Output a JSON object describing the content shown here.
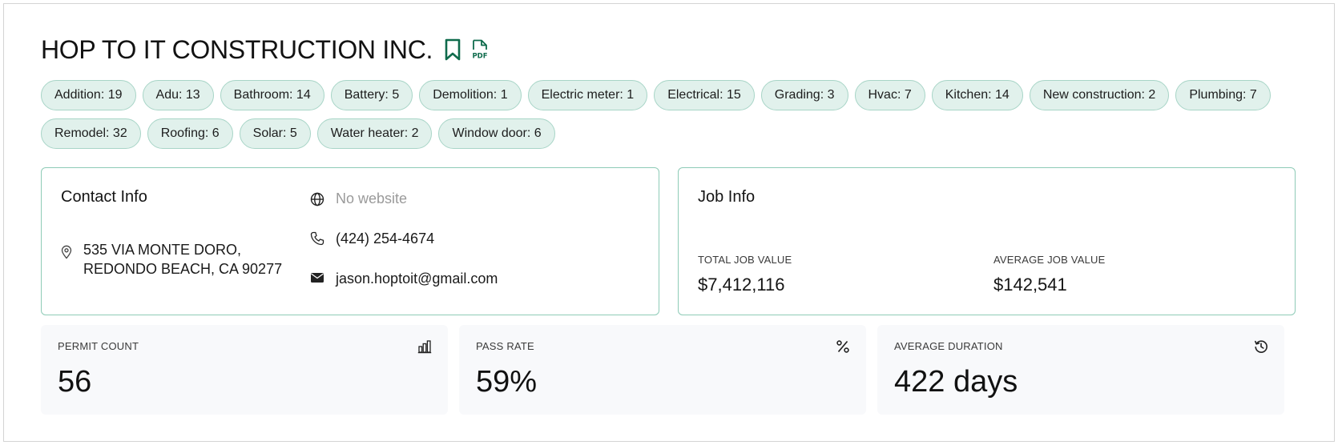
{
  "company": {
    "name": "HOP TO IT CONSTRUCTION INC.",
    "bookmark_icon": "bookmark-icon",
    "pdf_icon": "pdf-file-icon",
    "pdf_label": "PDF",
    "accent_color": "#0f6b4c"
  },
  "tags": [
    {
      "label": "Addition: 19"
    },
    {
      "label": "Adu: 13"
    },
    {
      "label": "Bathroom: 14"
    },
    {
      "label": "Battery: 5"
    },
    {
      "label": "Demolition: 1"
    },
    {
      "label": "Electric meter: 1"
    },
    {
      "label": "Electrical: 15"
    },
    {
      "label": "Grading: 3"
    },
    {
      "label": "Hvac: 7"
    },
    {
      "label": "Kitchen: 14"
    },
    {
      "label": "New construction: 2"
    },
    {
      "label": "Plumbing: 7"
    },
    {
      "label": "Remodel: 32"
    },
    {
      "label": "Roofing: 6"
    },
    {
      "label": "Solar: 5"
    },
    {
      "label": "Water heater: 2"
    },
    {
      "label": "Window door: 6"
    }
  ],
  "contact": {
    "title": "Contact Info",
    "address_line1": "535 VIA MONTE DORO,",
    "address_line2": "REDONDO BEACH, CA 90277",
    "website": "No website",
    "phone": "(424) 254-4674",
    "email": "jason.hoptoit@gmail.com"
  },
  "job": {
    "title": "Job Info",
    "total_label": "TOTAL JOB VALUE",
    "total_value": "$7,412,116",
    "average_label": "AVERAGE JOB VALUE",
    "average_value": "$142,541"
  },
  "stats": {
    "permit_count": {
      "label": "PERMIT COUNT",
      "value": "56",
      "icon": "bar-chart-icon"
    },
    "pass_rate": {
      "label": "PASS RATE",
      "value": "59%",
      "icon": "percent-icon"
    },
    "average_duration": {
      "label": "AVERAGE DURATION",
      "value": "422 days",
      "icon": "history-clock-icon"
    }
  }
}
